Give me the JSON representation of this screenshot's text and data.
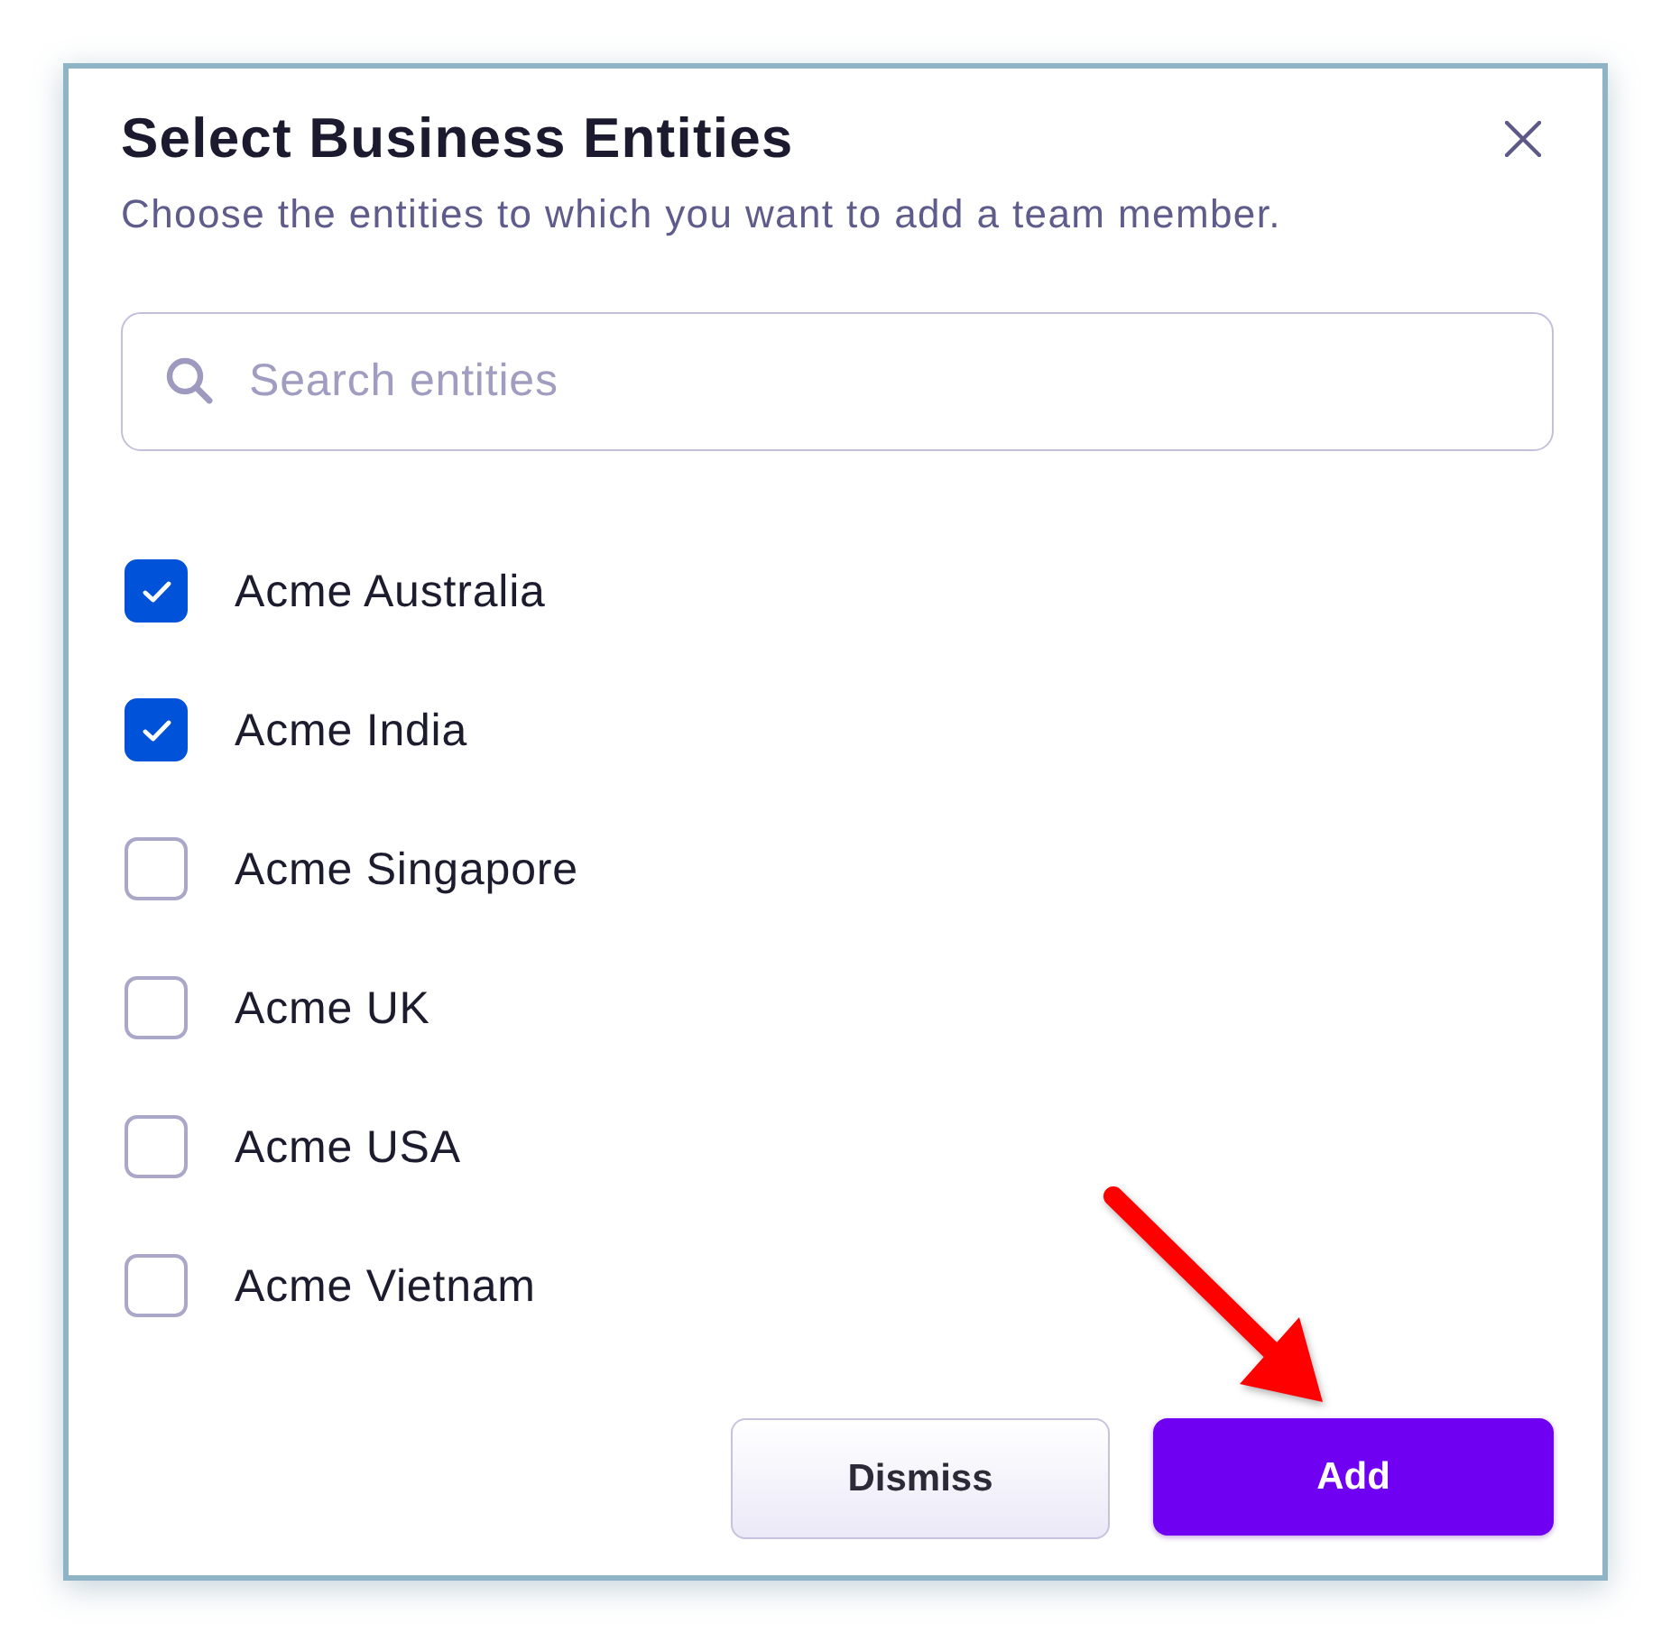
{
  "dialog": {
    "title": "Select Business Entities",
    "subtitle": "Choose the entities to which you want to add a team member."
  },
  "search": {
    "placeholder": "Search entities"
  },
  "entities": [
    {
      "label": "Acme Australia",
      "checked": true
    },
    {
      "label": "Acme India",
      "checked": true
    },
    {
      "label": "Acme Singapore",
      "checked": false
    },
    {
      "label": "Acme UK",
      "checked": false
    },
    {
      "label": "Acme USA",
      "checked": false
    },
    {
      "label": "Acme Vietnam",
      "checked": false
    }
  ],
  "buttons": [
    {
      "label": "Dismiss",
      "kind": "secondary"
    },
    {
      "label": "Add",
      "kind": "primary"
    }
  ],
  "annotations": [
    {
      "kind": "arrow"
    }
  ]
}
